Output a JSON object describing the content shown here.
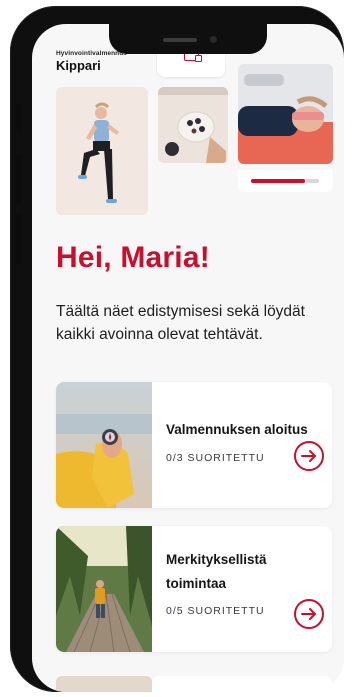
{
  "header": {
    "brand_subtitle": "Hyvinvointivalmennus",
    "brand_name": "Kippari"
  },
  "gallery": {
    "progress_fraction": 0.8
  },
  "greeting": "Hei, Maria!",
  "intro_text": "Täältä näet edistymisesi sekä löydät kaikki avoinna olevat tehtävät.",
  "cards": [
    {
      "title": "Valmennuksen aloitus",
      "status": "0/3 SUORITETTU"
    },
    {
      "title": "Merkityksellistä toimintaa",
      "status": "0/5 SUORITETTU"
    }
  ],
  "colors": {
    "accent": "#c8102e",
    "background": "#f7f7f8"
  },
  "icons": [
    "document-icon",
    "arrow-right-icon"
  ]
}
